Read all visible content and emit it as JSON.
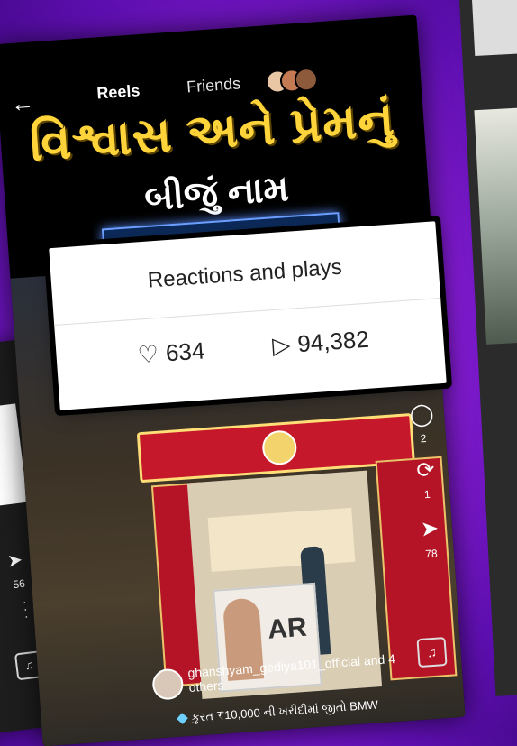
{
  "header": {
    "back_icon": "arrow-left-icon",
    "tabs": [
      {
        "label": "Reels"
      },
      {
        "label": "Friends"
      }
    ]
  },
  "reel": {
    "headline_line1": "વિશ્વાસ અને પ્રેમનું",
    "headline_line2": "બીજું નામ",
    "ar_label": "AR",
    "author_name": "ghanshyam_gediya101_official and 4",
    "author_others": "others",
    "caption": "કુરત ₹10,000 ની ખરીદીમાં જીતો BMW",
    "rail": {
      "comment_count": "2",
      "share_count": "1",
      "send_count": "78"
    }
  },
  "side_left": {
    "send_count": "56"
  },
  "popup": {
    "title": "Reactions and plays",
    "likes": "634",
    "plays": "94,382"
  },
  "colors": {
    "background": "#8a1fd6",
    "headline": "#ffd43b",
    "sign_red": "#c5182a"
  }
}
